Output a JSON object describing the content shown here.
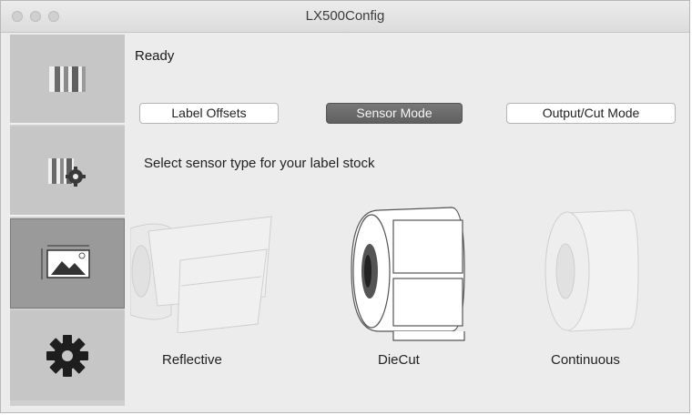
{
  "window": {
    "title": "LX500Config"
  },
  "status": {
    "text": "Ready"
  },
  "tabs": [
    {
      "label": "Label Offsets",
      "active": false
    },
    {
      "label": "Sensor Mode",
      "active": true
    },
    {
      "label": "Output/Cut Mode",
      "active": false
    }
  ],
  "prompt": "Select sensor type for your label stock",
  "sensor_options": [
    {
      "label": "Reflective",
      "selected": false
    },
    {
      "label": "DieCut",
      "selected": true
    },
    {
      "label": "Continuous",
      "selected": false
    }
  ],
  "sidebar": {
    "items": [
      {
        "icon": "printer-icon",
        "active": false
      },
      {
        "icon": "printer-settings-icon",
        "active": false
      },
      {
        "icon": "label-image-icon",
        "active": true
      },
      {
        "icon": "gear-icon",
        "active": false
      }
    ]
  },
  "colors": {
    "active_tab": "#666666",
    "sidebar_active": "#9a9a9a"
  }
}
